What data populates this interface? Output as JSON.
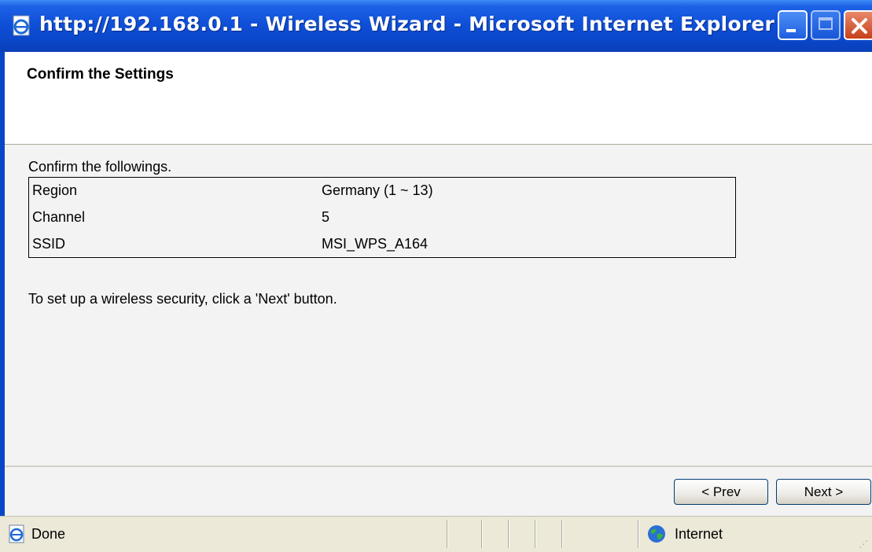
{
  "window": {
    "title": "http://192.168.0.1 - Wireless Wizard - Microsoft Internet Explorer"
  },
  "page": {
    "title": "Confirm the Settings",
    "intro": "Confirm the followings.",
    "settings": [
      {
        "label": "Region",
        "value": "Germany (1 ~ 13)"
      },
      {
        "label": "Channel",
        "value": "5"
      },
      {
        "label": "SSID",
        "value": "MSI_WPS_A164"
      }
    ],
    "note": "To set up a wireless security, click a 'Next' button."
  },
  "buttons": {
    "prev": "< Prev",
    "next": "Next >"
  },
  "status": {
    "text": "Done",
    "zone": "Internet"
  },
  "icons": {
    "title": "ie-page-icon",
    "status": "ie-page-icon",
    "zone": "globe-icon"
  }
}
